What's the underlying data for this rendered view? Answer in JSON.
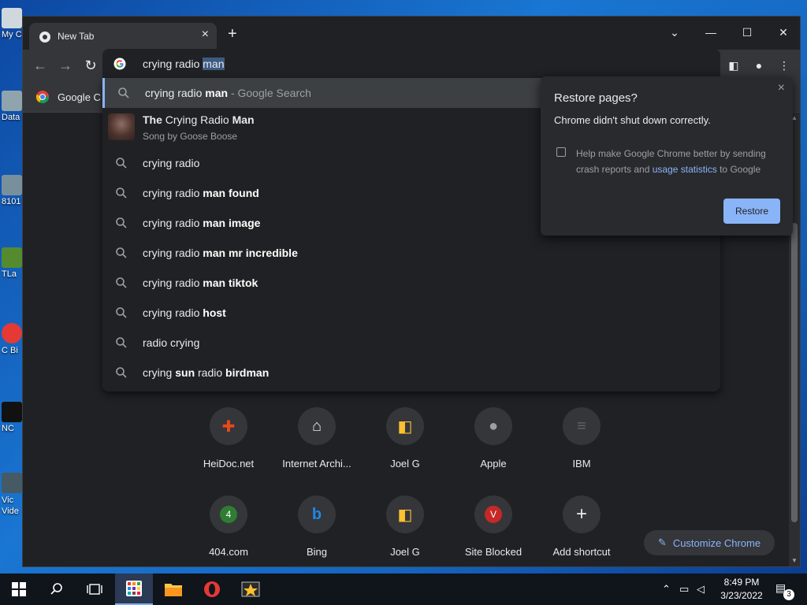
{
  "desktop": {
    "icons": [
      {
        "label": "My C",
        "color": "#cfd8dc"
      },
      {
        "label": "Data",
        "color": "#90a4ae"
      },
      {
        "label": "8101",
        "color": "#78909c"
      },
      {
        "label": "TLa",
        "color": "#558b2f"
      },
      {
        "label": "C Bi",
        "color": "#e53935"
      },
      {
        "label": "NC",
        "color": "#111111"
      },
      {
        "label": "Vic Vide",
        "color": "#455a64"
      }
    ]
  },
  "browser": {
    "tab": {
      "title": "New Tab",
      "close": "×"
    },
    "new_tab": "+",
    "window_controls": {
      "dropdown": "⌄",
      "minimize": "—",
      "maximize": "☐",
      "close": "✕"
    },
    "bookmark": {
      "label": "Google C"
    },
    "omnibox": {
      "typed": "crying radio ",
      "selected_completion": "man"
    },
    "suggestions": {
      "first": {
        "query": "crying radio ",
        "bold": "man",
        "suffix": " - Google Search"
      },
      "song": {
        "title_bold": "The",
        "title_mid": " Crying Radio ",
        "title_bold2": "Man",
        "subtitle": "Song by Goose Boose"
      },
      "items": [
        {
          "plain": "crying radio",
          "bold": ""
        },
        {
          "plain": "crying radio ",
          "bold": "man found"
        },
        {
          "plain": "crying radio ",
          "bold": "man image"
        },
        {
          "plain": "crying radio ",
          "bold": "man mr incredible"
        },
        {
          "plain": "crying radio ",
          "bold": "man tiktok"
        },
        {
          "plain": "crying radio ",
          "bold": "host"
        },
        {
          "plain": "radio crying",
          "bold": ""
        },
        {
          "plain": "crying ",
          "bold": "sun",
          "plain2": " radio ",
          "bold2": "birdman"
        }
      ]
    },
    "restore": {
      "title": "Restore pages?",
      "close": "×",
      "description": "Chrome didn't shut down correctly.",
      "help_pre": "Help make Google Chrome better by sending crash reports and ",
      "help_link": "usage statistics",
      "help_post": " to Google",
      "button": "Restore"
    },
    "shortcuts": [
      {
        "label": "HeiDoc.net",
        "glyph": "✚",
        "color": "#e64a19"
      },
      {
        "label": "Internet Archi...",
        "glyph": "🏛",
        "color": "#e8eaed"
      },
      {
        "label": "Joel G",
        "glyph": "◧",
        "color": "#fbc02d"
      },
      {
        "label": "Apple",
        "glyph": "",
        "color": "#9aa0a6"
      },
      {
        "label": "IBM",
        "glyph": "≡",
        "color": "#5f6368"
      },
      {
        "label": "404.com",
        "glyph": "4",
        "color": "#2e7d32"
      },
      {
        "label": "Bing",
        "glyph": "b",
        "color": "#1e88e5"
      },
      {
        "label": "Joel G",
        "glyph": "◧",
        "color": "#fbc02d"
      },
      {
        "label": "Site Blocked",
        "glyph": "V",
        "color": "#c62828"
      },
      {
        "label": "Add shortcut",
        "glyph": "+",
        "color": "#e8eaed"
      }
    ],
    "customize": {
      "label": "Customize Chrome",
      "icon": "✎"
    }
  },
  "taskbar": {
    "clock_time": "8:49 PM",
    "clock_date": "3/23/2022",
    "notification_count": "3"
  }
}
